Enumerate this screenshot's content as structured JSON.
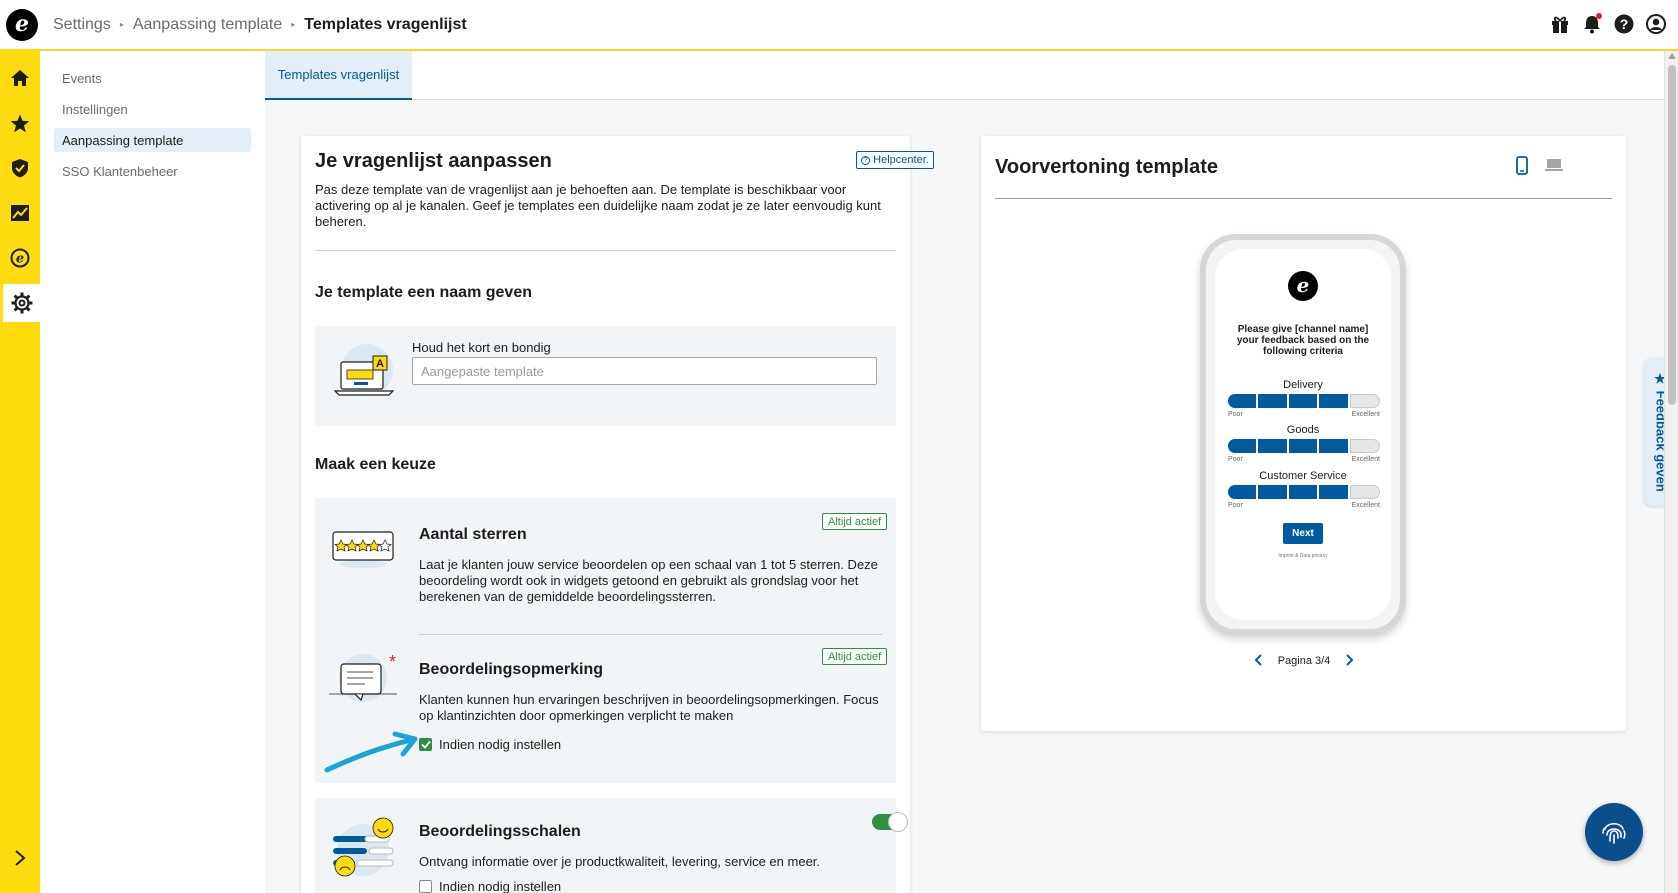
{
  "app": {
    "logo_letter": "e",
    "colors": {
      "rail": "#ffdc0f",
      "accent": "#005aa0",
      "success": "#2d8f3f"
    }
  },
  "header": {
    "breadcrumb": [
      "Settings",
      "Aanpassing template"
    ],
    "current": "Templates vragenlijst",
    "icons": [
      "gift-icon",
      "bell-icon",
      "help-icon",
      "user-icon"
    ]
  },
  "rail": {
    "items": [
      "home-icon",
      "star-icon",
      "shield-icon",
      "chart-icon",
      "trusted-e-icon",
      "settings-icon"
    ],
    "active": "settings-icon",
    "expand": "chevron-right-icon"
  },
  "subnav": {
    "items": [
      "Events",
      "Instellingen",
      "Aanpassing template",
      "SSO Klantenbeheer"
    ],
    "active": "Aanpassing template"
  },
  "tabs": [
    {
      "label": "Templates vragenlijst",
      "active": true
    }
  ],
  "editor": {
    "title": "Je vragenlijst aanpassen",
    "helpcenter": "Helpcenter.",
    "intro": "Pas deze template van de vragenlijst aan je behoeften aan. De template is beschikbaar voor activering op al je kanalen. Geef je templates een duidelijke naam zodat je ze later eenvoudig kunt beheren.",
    "name_section": {
      "title": "Je template een naam geven",
      "label": "Houd het kort en bondig",
      "placeholder": "Aangepaste template",
      "value": ""
    },
    "choice_title": "Maak een keuze",
    "options": [
      {
        "title": "Aantal sterren",
        "badge": "Altijd actief",
        "description": "Laat je klanten jouw service beoordelen op een schaal van 1 tot 5 sterren. Deze beoordeling wordt ook in widgets getoond en gebruikt als grondslag voor het berekenen van de gemiddelde beoordelingssterren."
      },
      {
        "title": "Beoordelingsopmerking",
        "badge": "Altijd actief",
        "description": "Klanten kunnen hun ervaringen beschrijven in beoordelingsopmerkingen. Focus op klantinzichten door opmerkingen verplicht te maken",
        "checkbox_label": "Indien nodig instellen",
        "checked": true
      },
      {
        "title": "Beoordelingsschalen",
        "description": "Ontvang informatie over je productkwaliteit, levering, service en meer.",
        "checkbox_label": "Indien nodig instellen",
        "checked": false,
        "toggle_on": true
      }
    ]
  },
  "preview": {
    "title": "Voorvertoning template",
    "device_icons": [
      "mobile-icon",
      "laptop-icon"
    ],
    "active_device": "mobile-icon",
    "phone": {
      "logo_letter": "e",
      "question": "Please give [channel name] your feedback based on the following criteria",
      "criteria": [
        {
          "name": "Delivery",
          "selected": 4,
          "of": 5
        },
        {
          "name": "Goods",
          "selected": 4,
          "of": 5
        },
        {
          "name": "Customer Service",
          "selected": 4,
          "of": 5
        }
      ],
      "low_label": "Poor",
      "high_label": "Excellent",
      "next": "Next",
      "imprint": "Imprint & Data privacy"
    },
    "pager": "Pagina 3/4"
  },
  "feedback_tab": "Feedback geven"
}
